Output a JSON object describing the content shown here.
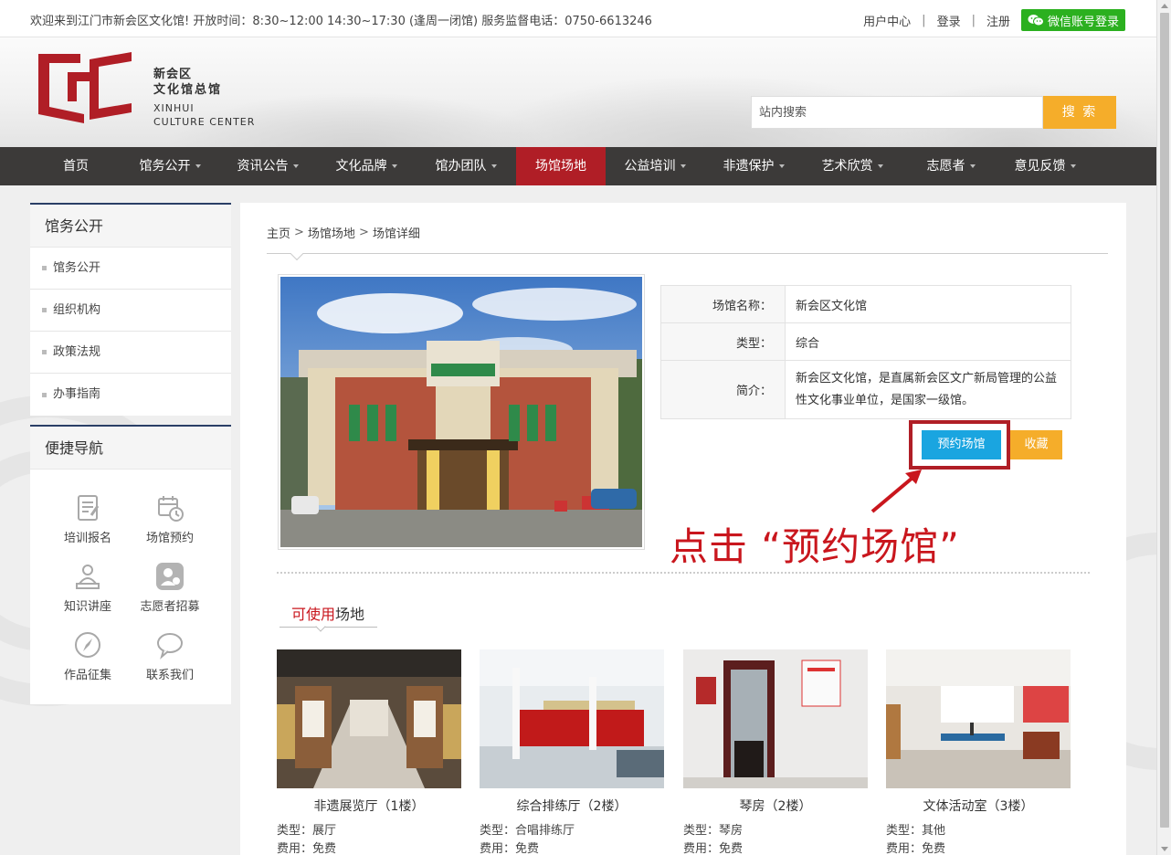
{
  "topbar": {
    "welcome": "欢迎来到江门市新会区文化馆! 开放时间：8:30~12:00 14:30~17:30 (逢周一闭馆) 服务监督电话：0750-6613246",
    "user_center": "用户中心",
    "login": "登录",
    "register": "注册",
    "separator": "|",
    "wechat_login": "微信账号登录",
    "wechat_icon": "wechat-icon"
  },
  "logo": {
    "cn_line1": "新会区",
    "cn_line2": "文化馆总馆",
    "en_line1": "XINHUI",
    "en_line2": "CULTURE CENTER",
    "brand_color": "#b01e26"
  },
  "search": {
    "placeholder": "站内搜索",
    "button": "搜 索",
    "button_color": "#f5ad2a"
  },
  "nav": {
    "active_color": "#b01e26",
    "items": [
      {
        "label": "首页"
      },
      {
        "label": "馆务公开"
      },
      {
        "label": "资讯公告"
      },
      {
        "label": "文化品牌"
      },
      {
        "label": "馆办团队"
      },
      {
        "label": "场馆场地"
      },
      {
        "label": "公益培训"
      },
      {
        "label": "非遗保护"
      },
      {
        "label": "艺术欣赏"
      },
      {
        "label": "志愿者"
      },
      {
        "label": "意见反馈"
      }
    ]
  },
  "sidebar": {
    "panel1_title": "馆务公开",
    "panel1_items": [
      {
        "label": "馆务公开"
      },
      {
        "label": "组织机构"
      },
      {
        "label": "政策法规"
      },
      {
        "label": "办事指南"
      }
    ],
    "panel2_title": "便捷导航",
    "quick_links": [
      {
        "label": "培训报名",
        "icon": "training-signup-icon"
      },
      {
        "label": "场馆预约",
        "icon": "calendar-clock-icon"
      },
      {
        "label": "知识讲座",
        "icon": "lecture-icon"
      },
      {
        "label": "志愿者招募",
        "icon": "volunteer-icon"
      },
      {
        "label": "作品征集",
        "icon": "compass-icon"
      },
      {
        "label": "联系我们",
        "icon": "chat-bubble-icon"
      }
    ]
  },
  "breadcrumb": {
    "items": [
      "主页",
      "场馆场地",
      "场馆详细"
    ],
    "separator": ">"
  },
  "venue": {
    "name_label": "场馆名称：",
    "name_value": "新会区文化馆",
    "type_label": "类型：",
    "type_value": "综合",
    "intro_label": "简介：",
    "intro_value": "新会区文化馆，是直属新会区文广新局管理的公益性文化事业单位，是国家一级馆。",
    "book_button": "预约场馆",
    "fav_button": "收藏",
    "book_color": "#1aa5e0"
  },
  "annotation": {
    "text": "点击 “预约场馆”",
    "color": "#c9161d"
  },
  "rooms_section": {
    "title_red": "可使用",
    "title_rest": "场地",
    "rooms": [
      {
        "name": "非遗展览厅（1楼）",
        "type": "类型：展厅",
        "fee": "费用：免费"
      },
      {
        "name": "综合排练厅（2楼）",
        "type": "类型：合唱排练厅",
        "fee": "费用：免费"
      },
      {
        "name": "琴房（2楼）",
        "type": "类型：琴房",
        "fee": "费用：免费"
      },
      {
        "name": "文体活动室（3楼）",
        "type": "类型：其他",
        "fee": "费用：免费"
      }
    ]
  }
}
